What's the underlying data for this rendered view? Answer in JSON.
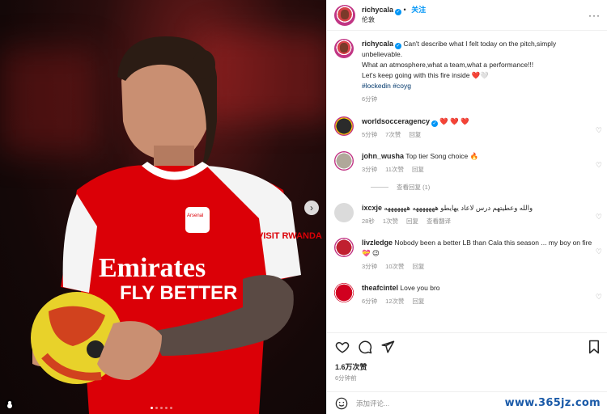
{
  "post_author": {
    "username": "richycala",
    "follow_label": "关注",
    "location": "伦敦",
    "verified": true
  },
  "caption": {
    "username": "richycala",
    "lines": [
      "Can't describe what I felt today on the pitch,simply unbelievable.",
      "What an atmosphere,what a team,what a performance!!!",
      "Let's keep going with this fire inside ❤️🤍"
    ],
    "hashtags": "#lockedin #coyg",
    "time": "6分钟"
  },
  "comments": [
    {
      "username": "worldsocceragency",
      "verified": true,
      "text": "❤️ ❤️ ❤️",
      "time": "5分钟",
      "likes": "7次赞",
      "reply": "回复"
    },
    {
      "username": "john_wusha",
      "verified": false,
      "text": "Top tier Song choice 🔥",
      "time": "3分钟",
      "likes": "11次赞",
      "reply": "回复",
      "view_replies": "查看回复 (1)"
    },
    {
      "username": "ixcxje",
      "verified": false,
      "text": "والله وعطيتهم درس لاعاد يهايطو هههههههه هههههههه",
      "time": "28秒",
      "likes": "1次赞",
      "reply": "回复",
      "translate": "查看翻译"
    },
    {
      "username": "livzledge",
      "verified": false,
      "text": "Nobody been a better LB than Cala this season ... my boy on fire 💝 😉",
      "time": "3分钟",
      "likes": "10次赞",
      "reply": "回复"
    },
    {
      "username": "theafcintel",
      "verified": false,
      "text": "Love you bro",
      "time": "6分钟",
      "likes": "12次赞",
      "reply": "回复"
    }
  ],
  "actions": {
    "like_icon": "heart-outline-icon",
    "comment_icon": "speech-bubble-icon",
    "share_icon": "paper-plane-icon",
    "save_icon": "bookmark-icon"
  },
  "likes_count": "1.6万次赞",
  "posted_ago": "6分钟前",
  "add_comment_placeholder": "添加评论...",
  "photo": {
    "jersey_sponsor_line1": "Emirates",
    "jersey_sponsor_line2": "FLY BETTER",
    "sleeve_text": "VISIT RWANDA",
    "crest_text": "Arsenal",
    "carousel_dots": 5,
    "active_dot": 0
  },
  "watermark": "www.365jz.com",
  "colors": {
    "accent": "#0095f6",
    "heart": "#ed4956",
    "jersey_red": "#db0007"
  }
}
